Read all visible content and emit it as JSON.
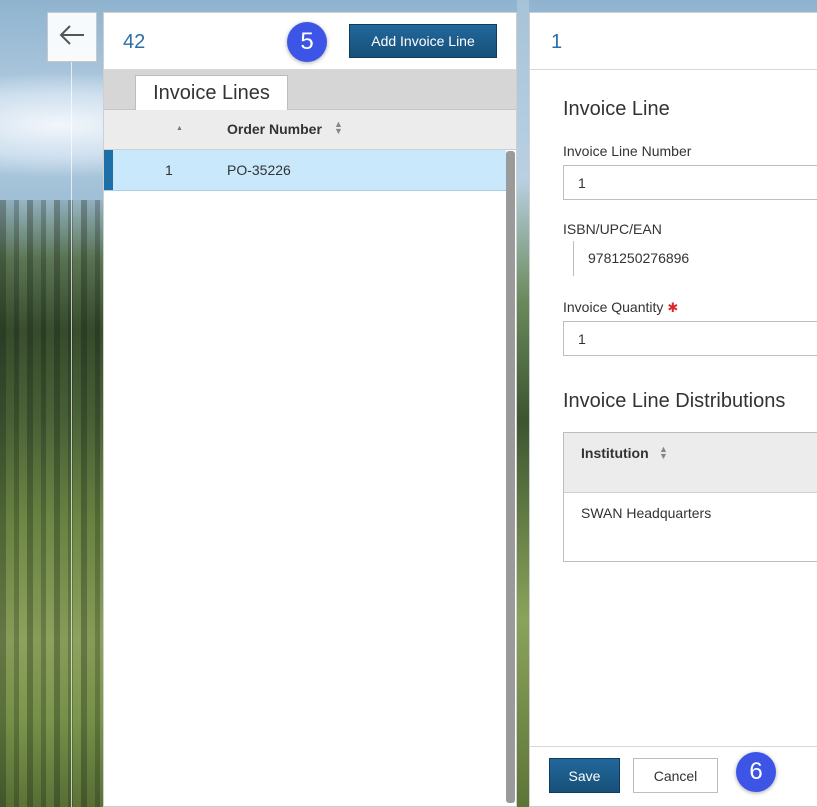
{
  "nav": {
    "back_icon": "arrow-left-icon"
  },
  "left_panel": {
    "record_id": "42",
    "step_badge": "5",
    "add_button_label": "Add Invoice Line",
    "tab_label": "Invoice Lines",
    "columns": {
      "order_number": "Order Number"
    },
    "rows": [
      {
        "line": "1",
        "order_number": "PO-35226"
      }
    ]
  },
  "right_panel": {
    "record_id": "1",
    "section_title": "Invoice Line",
    "fields": {
      "line_number_label": "Invoice Line Number",
      "line_number_value": "1",
      "isbn_label": "ISBN/UPC/EAN",
      "isbn_value": "9781250276896",
      "quantity_label": "Invoice Quantity",
      "quantity_value": "1"
    },
    "distributions": {
      "title": "Invoice Line Distributions",
      "column": "Institution",
      "rows": [
        {
          "institution": "SWAN Headquarters"
        }
      ]
    },
    "footer": {
      "save_label": "Save",
      "cancel_label": "Cancel",
      "step_badge": "6"
    }
  },
  "colors": {
    "accent": "#1d6fa8",
    "selected_row": "#c9e8fb",
    "badge": "#3d55e6",
    "required": "#e0262d"
  }
}
